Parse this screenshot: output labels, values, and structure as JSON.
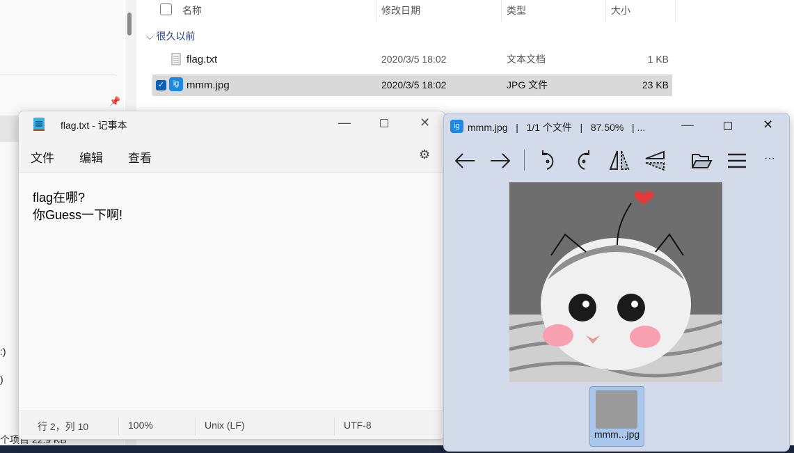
{
  "explorer": {
    "columns": {
      "name": "名称",
      "date": "修改日期",
      "type": "类型",
      "size": "大小"
    },
    "group": "很久以前",
    "files": [
      {
        "name": "flag.txt",
        "date": "2020/3/5 18:02",
        "type": "文本文档",
        "size": "1 KB",
        "selected": false
      },
      {
        "name": "mmm.jpg",
        "date": "2020/3/5 18:02",
        "type": "JPG 文件",
        "size": "23 KB",
        "selected": true
      }
    ],
    "sidebar_fragments": [
      ":)",
      ")"
    ],
    "status": "个项目  22.9 KB"
  },
  "notepad": {
    "title": "flag.txt - 记事本",
    "menu": [
      "文件",
      "编辑",
      "查看"
    ],
    "content": "flag在哪?\n你Guess一下啊!",
    "status": {
      "position": "行 2，列 10",
      "zoom": "100%",
      "line_ending": "Unix (LF)",
      "encoding": "UTF-8"
    }
  },
  "viewer": {
    "title": "mmm.jpg   |   1/1 个文件   |   87.50%   | ...",
    "thumbnail_label": "mmm...jpg",
    "accent": "#1e88e5"
  }
}
